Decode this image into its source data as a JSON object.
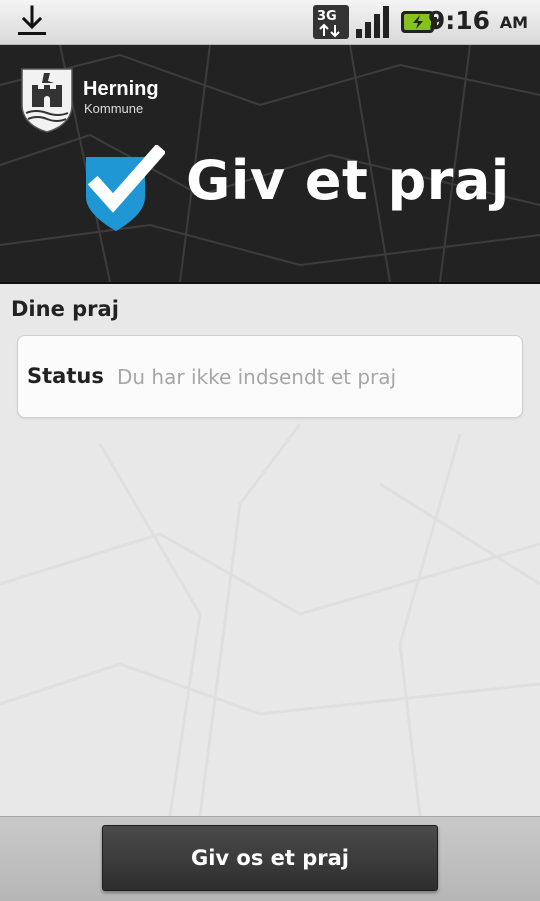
{
  "status_bar": {
    "time": "9:16",
    "ampm": "AM",
    "network": "3G",
    "icons": [
      "download-icon",
      "network-3g-icon",
      "signal-icon",
      "battery-charging-icon"
    ]
  },
  "header": {
    "org_name": "Herning",
    "org_sub": "Kommune",
    "app_title": "Giv et praj",
    "icons": [
      "crest-icon",
      "checkmark-shield-icon"
    ]
  },
  "main": {
    "section_title": "Dine praj",
    "status_label": "Status",
    "status_value": "Du har ikke indsendt et praj"
  },
  "footer": {
    "button_label": "Giv os et praj"
  },
  "colors": {
    "header_bg": "#222222",
    "accent_blue": "#1f97d4",
    "button_bg": "#3a3a3a"
  }
}
